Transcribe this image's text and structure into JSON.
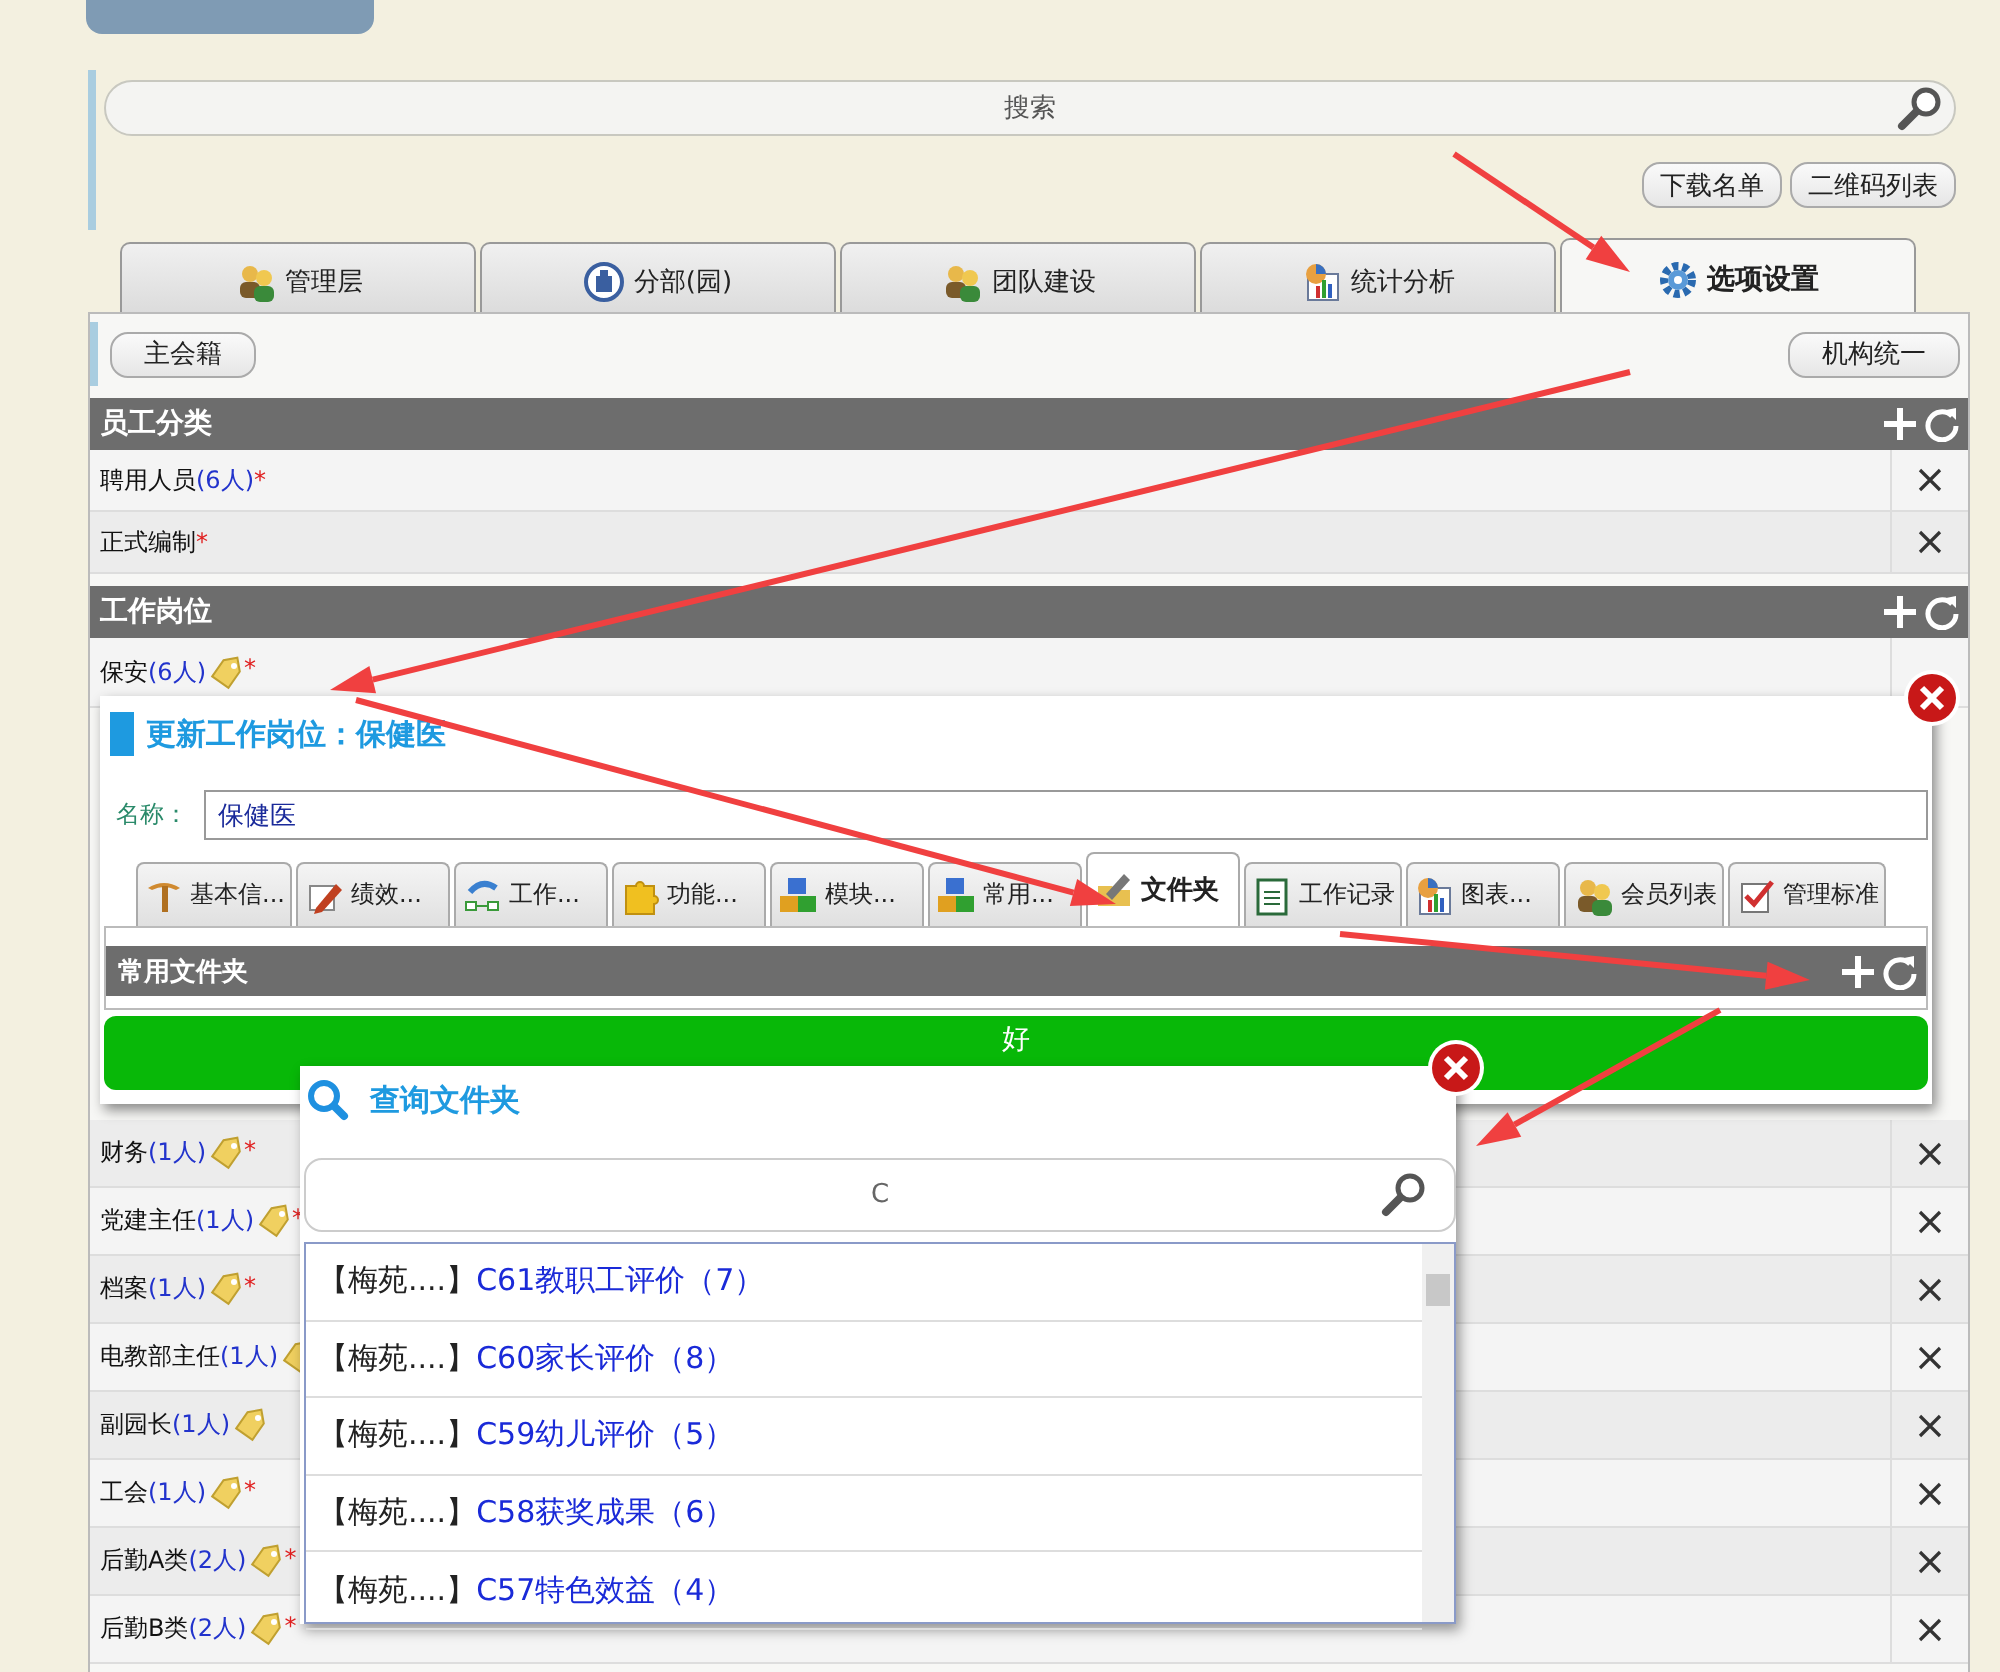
{
  "search": {
    "placeholder": "搜索"
  },
  "top_buttons": [
    "下载名单",
    "二维码列表"
  ],
  "tabs": [
    {
      "label": "管理层",
      "selected": false
    },
    {
      "label": "分部(园)",
      "selected": false
    },
    {
      "label": "团队建设",
      "selected": false
    },
    {
      "label": "统计分析",
      "selected": false
    },
    {
      "label": "选项设置",
      "selected": true
    }
  ],
  "toolbar": {
    "left_button": "主会籍",
    "right_button": "机构统一"
  },
  "sections": [
    {
      "title": "员工分类",
      "rows": [
        {
          "name": "聘用人员",
          "count": "(6人)",
          "tagged": false,
          "mark": "*"
        },
        {
          "name": "正式编制",
          "tagged": false,
          "mark": "*"
        }
      ]
    },
    {
      "title": "工作岗位",
      "rows": [
        {
          "name": "保安",
          "count": "(6人)",
          "tagged": true,
          "mark": "*"
        },
        {
          "name": "财务",
          "count": "(1人)",
          "tagged": true,
          "mark": "*"
        },
        {
          "name": "党建主任",
          "count": "(1人)",
          "tagged": true,
          "mark": "*"
        },
        {
          "name": "档案",
          "count": "(1人)",
          "tagged": true,
          "mark": "*"
        },
        {
          "name": "电教部主任",
          "count": "(1人)",
          "tagged": true
        },
        {
          "name": "副园长",
          "count": "(1人)",
          "tagged": true
        },
        {
          "name": "工会",
          "count": "(1人)",
          "tagged": true,
          "mark": "*"
        },
        {
          "name": "后勤A类",
          "count": "(2人)",
          "tagged": true,
          "mark": "*"
        },
        {
          "name": "后勤B类",
          "count": "(2人)",
          "tagged": true,
          "mark": "*"
        }
      ]
    }
  ],
  "dialog": {
    "title": "更新工作岗位：保健医",
    "name_label": "名称：",
    "name_value": "保健医",
    "tabs": [
      {
        "label": "基本信...",
        "selected": false
      },
      {
        "label": "绩效...",
        "selected": false
      },
      {
        "label": "工作...",
        "selected": false
      },
      {
        "label": "功能...",
        "selected": false
      },
      {
        "label": "模块...",
        "selected": false
      },
      {
        "label": "常用...",
        "selected": false
      },
      {
        "label": "文件夹",
        "selected": true
      },
      {
        "label": "工作记录",
        "selected": false
      },
      {
        "label": "图表...",
        "selected": false
      },
      {
        "label": "会员列表",
        "selected": false
      },
      {
        "label": "管理标准",
        "selected": false
      }
    ],
    "section_title": "常用文件夹",
    "ok_button": "好"
  },
  "search_dialog": {
    "title": "查询文件夹",
    "query": "C",
    "results": [
      {
        "prefix": "【梅苑....】",
        "name": "C61教职工评价（7）"
      },
      {
        "prefix": "【梅苑....】",
        "name": "C60家长评价（8）"
      },
      {
        "prefix": "【梅苑....】",
        "name": "C59幼儿评价（5）"
      },
      {
        "prefix": "【梅苑....】",
        "name": "C58获奖成果（6）"
      },
      {
        "prefix": "【梅苑....】",
        "name": "C57特色效益（4）"
      }
    ]
  }
}
